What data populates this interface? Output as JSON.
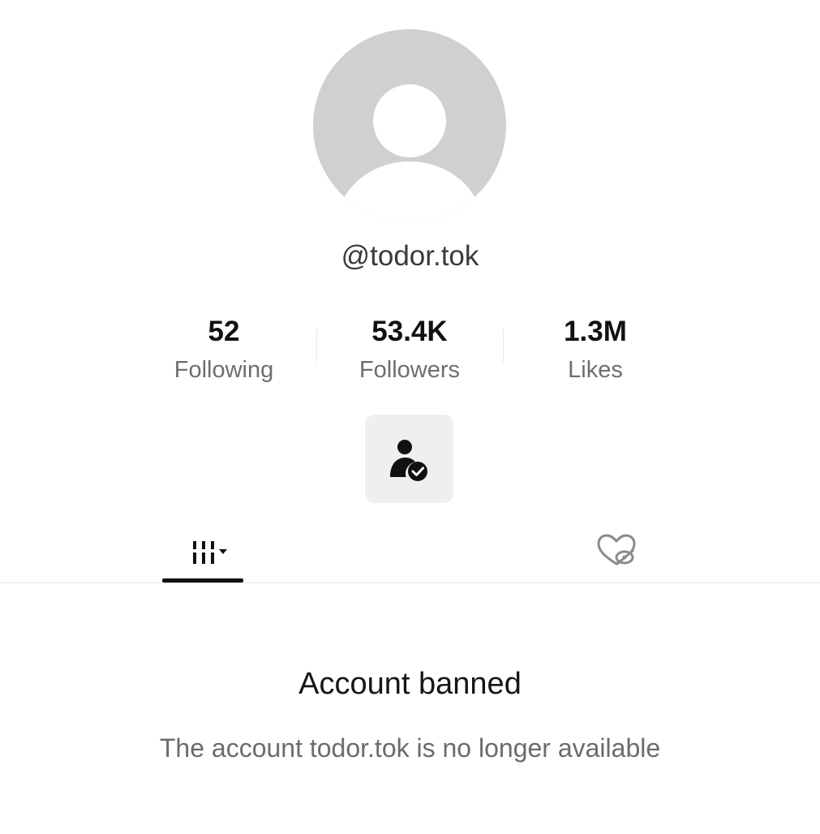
{
  "profile": {
    "username": "@todor.tok"
  },
  "stats": {
    "following": {
      "value": "52",
      "label": "Following"
    },
    "followers": {
      "value": "53.4K",
      "label": "Followers"
    },
    "likes": {
      "value": "1.3M",
      "label": "Likes"
    }
  },
  "actions": {
    "friend_icon": "person-check-icon"
  },
  "tabs": {
    "videos_icon": "grid-columns-icon",
    "liked_icon": "hidden-heart-icon",
    "active_tab": "videos"
  },
  "banned": {
    "title": "Account banned",
    "description": "The account todor.tok is no longer available"
  },
  "colors": {
    "avatar_placeholder": "#d0d0d0",
    "button_bg": "#efefef",
    "secondary_text": "#6e6e6e"
  }
}
